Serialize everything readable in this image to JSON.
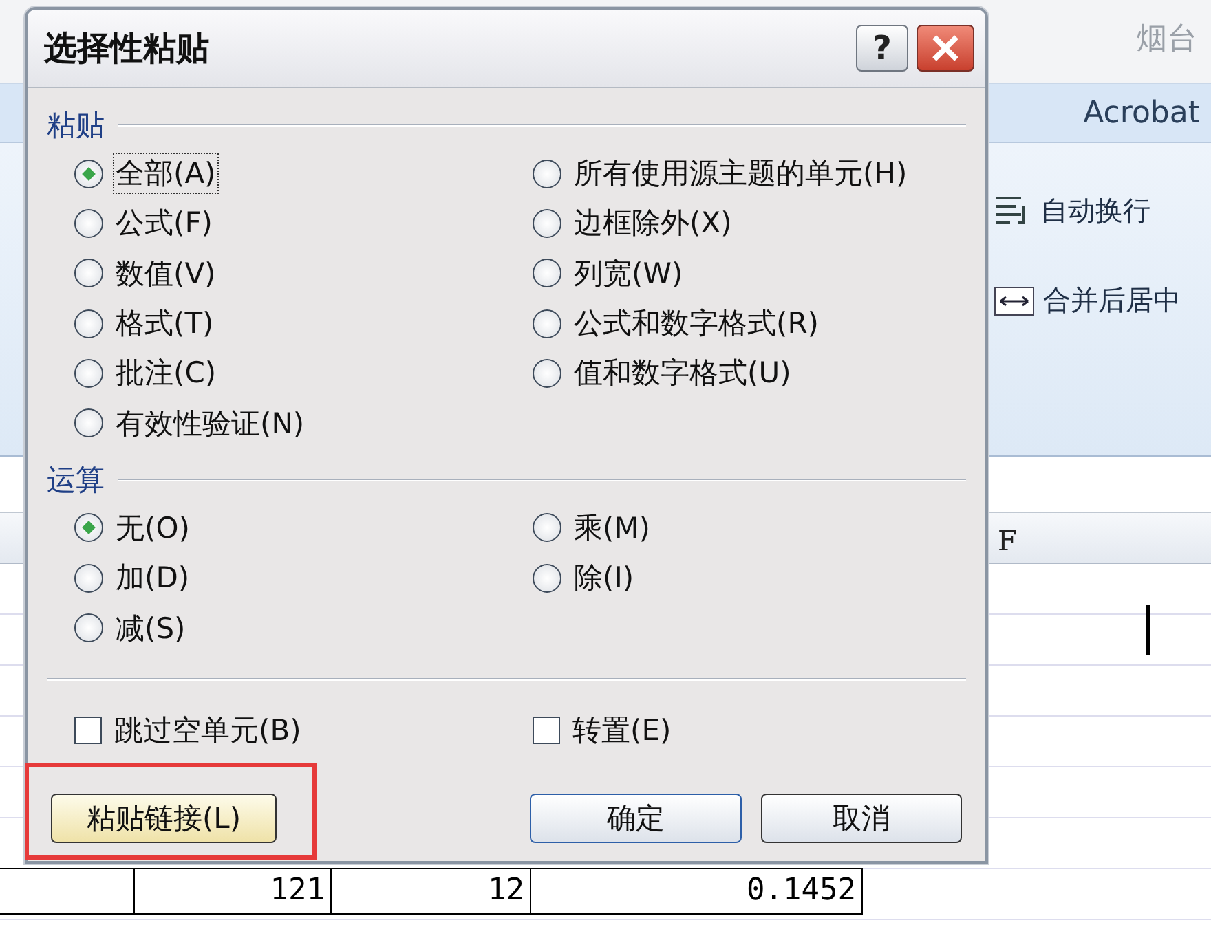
{
  "spreadsheet": {
    "title_fragment": "烟台",
    "ribbon_tab": "Acrobat",
    "ribbon_buttons": [
      {
        "label": "自动换行",
        "kind": "wrap"
      },
      {
        "label": "合并后居中",
        "kind": "merge"
      }
    ],
    "column_header": "F",
    "row_cells": [
      "121",
      "12",
      "0.1452"
    ]
  },
  "dialog": {
    "title": "选择性粘贴",
    "help": "?",
    "paste_group": {
      "label": "粘贴",
      "options": [
        {
          "label": "全部(A)",
          "selected": true,
          "focused": true
        },
        {
          "label": "公式(F)",
          "selected": false,
          "focused": false
        },
        {
          "label": "数值(V)",
          "selected": false,
          "focused": false
        },
        {
          "label": "格式(T)",
          "selected": false,
          "focused": false
        },
        {
          "label": "批注(C)",
          "selected": false,
          "focused": false
        },
        {
          "label": "有效性验证(N)",
          "selected": false,
          "focused": false
        },
        {
          "label": "所有使用源主题的单元(H)",
          "selected": false,
          "focused": false
        },
        {
          "label": "边框除外(X)",
          "selected": false,
          "focused": false
        },
        {
          "label": "列宽(W)",
          "selected": false,
          "focused": false
        },
        {
          "label": "公式和数字格式(R)",
          "selected": false,
          "focused": false
        },
        {
          "label": "值和数字格式(U)",
          "selected": false,
          "focused": false
        }
      ]
    },
    "operation_group": {
      "label": "运算",
      "options": [
        {
          "label": "无(O)",
          "selected": true
        },
        {
          "label": "加(D)",
          "selected": false
        },
        {
          "label": "减(S)",
          "selected": false
        },
        {
          "label": "乘(M)",
          "selected": false
        },
        {
          "label": "除(I)",
          "selected": false
        }
      ]
    },
    "checkboxes": [
      {
        "label": "跳过空单元(B)",
        "checked": false
      },
      {
        "label": "转置(E)",
        "checked": false
      }
    ],
    "buttons": [
      {
        "label": "粘贴链接(L)",
        "kind": "link",
        "highlighted": true
      },
      {
        "label": "确定",
        "kind": "ok",
        "highlighted": false
      },
      {
        "label": "取消",
        "kind": "cancel",
        "highlighted": false
      }
    ]
  }
}
